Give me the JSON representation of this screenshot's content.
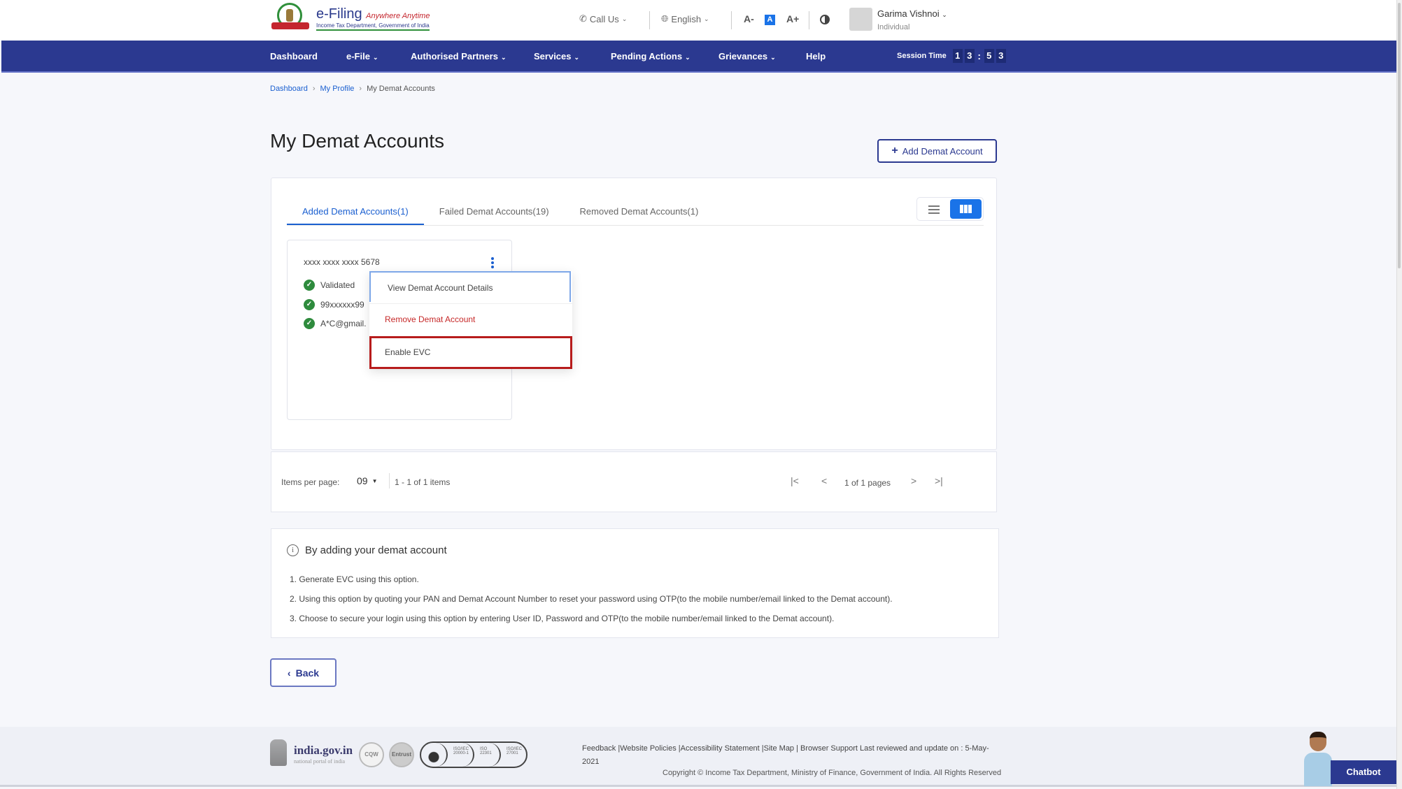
{
  "header": {
    "logo_title": "e-Filing",
    "logo_tagline": "Anywhere Anytime",
    "logo_subtitle": "Income Tax Department, Government of India",
    "call_us": "Call Us",
    "language": "English",
    "font_decrease": "A-",
    "font_default": "A",
    "font_increase": "A+",
    "user_name": "Garima Vishnoi",
    "user_role": "Individual"
  },
  "nav": {
    "items": [
      {
        "label": "Dashboard",
        "has_dropdown": false
      },
      {
        "label": "e-File",
        "has_dropdown": true
      },
      {
        "label": "Authorised Partners",
        "has_dropdown": true
      },
      {
        "label": "Services",
        "has_dropdown": true
      },
      {
        "label": "Pending Actions",
        "has_dropdown": true
      },
      {
        "label": "Grievances",
        "has_dropdown": true
      },
      {
        "label": "Help",
        "has_dropdown": false
      }
    ],
    "session_label": "Session Time",
    "session_digits": [
      "1",
      "3",
      "5",
      "3"
    ]
  },
  "breadcrumb": {
    "items": [
      "Dashboard",
      "My Profile",
      "My Demat Accounts"
    ]
  },
  "page": {
    "title": "My Demat Accounts",
    "add_button": "Add Demat Account",
    "back_button": "Back"
  },
  "tabs": [
    {
      "label": "Added Demat Accounts(1)",
      "active": true
    },
    {
      "label": "Failed Demat Accounts(19)",
      "active": false
    },
    {
      "label": "Removed Demat Accounts(1)",
      "active": false
    }
  ],
  "view_mode": "grid",
  "account_card": {
    "number": "xxxx xxxx xxxx 5678",
    "lines": [
      "Validated",
      "99xxxxxx99",
      "A*C@gmail."
    ]
  },
  "context_menu": {
    "items": [
      "View Demat Account Details",
      "Remove Demat Account",
      "Enable EVC"
    ],
    "highlighted": "Enable EVC"
  },
  "pagination": {
    "items_per_page_label": "Items per page:",
    "items_per_page": "09",
    "range": "1 - 1 of 1 items",
    "page_info": "1 of 1 pages"
  },
  "info": {
    "heading": "By adding your demat account",
    "lines": [
      "1. Generate EVC using this option.",
      "2. Using this option by quoting your PAN and Demat Account Number to reset your password using OTP(to the mobile number/email linked to the Demat account).",
      "3. Choose to secure your login using this option by entering User ID, Password and OTP(to the mobile number/email linked to the Demat account)."
    ]
  },
  "footer": {
    "india_gov": "india.gov.in",
    "india_gov_sub": "national portal of india",
    "badges": [
      "CQW",
      "Entrust"
    ],
    "certs": [
      "bsi",
      "ISO/IEC 20000-1",
      "ISO 22301",
      "ISO/IEC 27001"
    ],
    "links": "Feedback |Website Policies |Accessibility Statement |Site Map | Browser Support   Last reviewed and update on : 5-May-2021",
    "copyright": "Copyright © Income Tax Department, Ministry of Finance, Government of India. All Rights Reserved",
    "chatbot": "Chatbot"
  }
}
